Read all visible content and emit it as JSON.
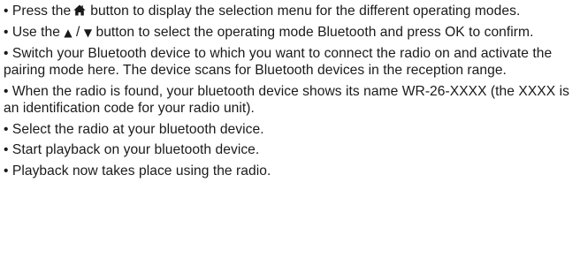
{
  "instructions": [
    {
      "bullet": "•",
      "before_icon": " Press the",
      "icon": "home-icon",
      "after_icon": "button to display the selection menu for the different operating modes."
    },
    {
      "bullet": "•",
      "pre": " Use the ",
      "arrow_up": "▲",
      "separator": " / ",
      "arrow_down": "▼",
      "post": " button to select the operating mode Bluetooth and press OK to confirm."
    },
    {
      "bullet": "•",
      "text": " Switch your Bluetooth device to which you want to connect the radio on and activate the pairing mode here. The device scans for Bluetooth devices in the reception range."
    },
    {
      "bullet": "•",
      "text": " When the radio is found, your bluetooth device shows its name WR-26-XXXX (the XXXX is an identification code for your radio unit)."
    },
    {
      "bullet": "•",
      "text": " Select the radio at your bluetooth device."
    },
    {
      "bullet": "•",
      "text": " Start playback on your bluetooth device."
    },
    {
      "bullet": "•",
      "text": " Playback now takes place using the radio."
    }
  ]
}
